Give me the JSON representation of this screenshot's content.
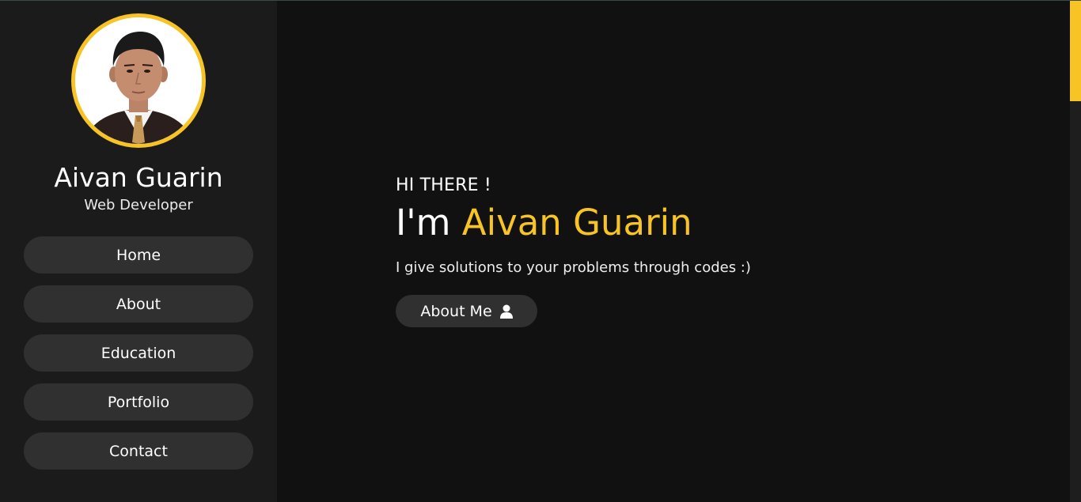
{
  "profile": {
    "name": "Aivan Guarin",
    "role": "Web Developer"
  },
  "nav": {
    "items": [
      {
        "label": "Home"
      },
      {
        "label": "About"
      },
      {
        "label": "Education"
      },
      {
        "label": "Portfolio"
      },
      {
        "label": "Contact"
      }
    ]
  },
  "hero": {
    "greeting": "HI THERE !",
    "headline_prefix": "I'm ",
    "headline_name": "Aivan Guarin",
    "tagline": "I give solutions to your problems through codes :)",
    "cta_label": "About Me",
    "cta_icon": "user-icon"
  },
  "colors": {
    "accent": "#f7c325",
    "background": "#111111",
    "sidebar": "#1b1b1b",
    "button": "#303030"
  }
}
